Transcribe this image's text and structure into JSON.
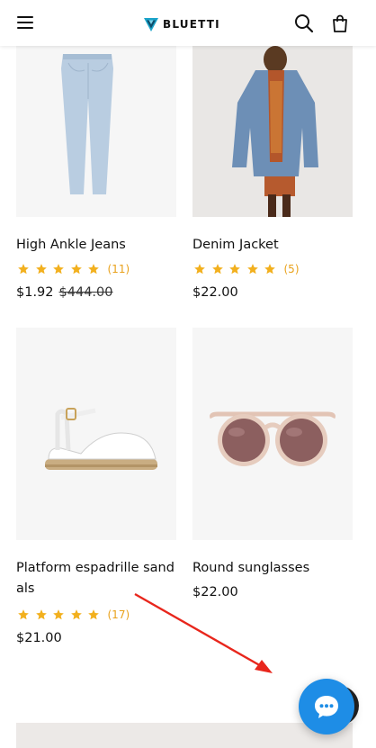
{
  "header": {
    "logo_text": "BLUETTI",
    "icons": [
      "menu-icon",
      "search-icon",
      "shopping-bag-icon"
    ]
  },
  "products": [
    {
      "title": "High Ankle Jeans",
      "rating_count": "(11)",
      "price": "$1.92",
      "old_price": "$444.00",
      "stars": 5
    },
    {
      "title": "Denim Jacket",
      "rating_count": "(5)",
      "price": "$22.00",
      "old_price": "",
      "stars": 5
    },
    {
      "title_line1": "Platform espadrille sand",
      "title_line2": "als",
      "rating_count": "(17)",
      "price": "$21.00",
      "old_price": "",
      "stars": 5
    },
    {
      "title": "Round sunglasses",
      "rating_count": "",
      "price": "$22.00",
      "old_price": "",
      "stars": 0
    }
  ],
  "colors": {
    "star": "#f2b01e",
    "chat_button": "#1e8de6",
    "annotation_arrow": "#e8261c"
  },
  "chat": {
    "icon": "chat-bubble-icon"
  }
}
